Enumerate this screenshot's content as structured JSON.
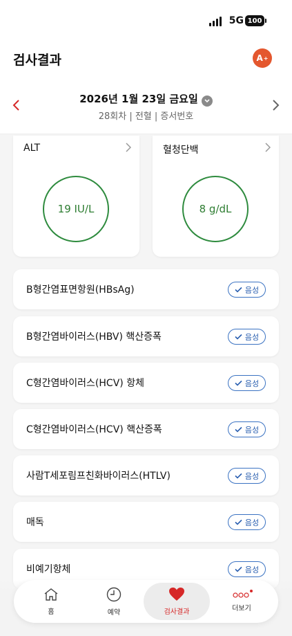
{
  "status_bar": {
    "network": "5G",
    "battery": "100"
  },
  "header": {
    "title": "검사결과",
    "avatar_label": "A"
  },
  "date_selector": {
    "date": "2026년 1월 23일 금요일",
    "subtitle": "28회차 | 전혈 | 증서번호"
  },
  "metrics": [
    {
      "name": "ALT",
      "value": "19 IU/L"
    },
    {
      "name": "혈청단백",
      "value": "8 g/dL"
    }
  ],
  "results": [
    {
      "label": "B형간염표면항원(HBsAg)",
      "result": "음성"
    },
    {
      "label": "B형간염바이러스(HBV) 핵산증폭",
      "result": "음성"
    },
    {
      "label": "C형간염바이러스(HCV) 항체",
      "result": "음성"
    },
    {
      "label": "C형간염바이러스(HCV) 핵산증폭",
      "result": "음성"
    },
    {
      "label": "사람T세포림프친화바이러스(HTLV)",
      "result": "음성"
    },
    {
      "label": "매독",
      "result": "음성"
    },
    {
      "label": "비예기항체",
      "result": "음성"
    }
  ],
  "bottom_nav": [
    {
      "label": "홈",
      "icon": "home-icon"
    },
    {
      "label": "예약",
      "icon": "clock-icon"
    },
    {
      "label": "검사결과",
      "icon": "heart-icon",
      "active": true
    },
    {
      "label": "더보기",
      "icon": "more-icon"
    }
  ],
  "colors": {
    "accent_red": "#d62828",
    "ring_green": "#2e8b3e",
    "badge_blue": "#3a72c2",
    "avatar": "#e4572e"
  }
}
